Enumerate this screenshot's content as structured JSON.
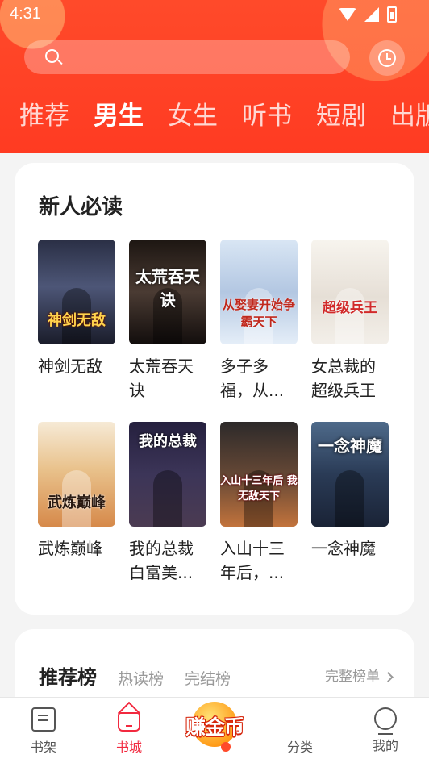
{
  "status_bar": {
    "time": "4:31"
  },
  "search": {
    "placeholder": ""
  },
  "tabs": [
    {
      "label": "推荐",
      "active": false
    },
    {
      "label": "男生",
      "active": true
    },
    {
      "label": "女生",
      "active": false
    },
    {
      "label": "听书",
      "active": false
    },
    {
      "label": "短剧",
      "active": false
    },
    {
      "label": "出版",
      "active": false
    }
  ],
  "section1": {
    "title": "新人必读",
    "books": [
      {
        "title": "神剑无敌",
        "cover_text": "神剑无敌"
      },
      {
        "title": "太荒吞天诀",
        "cover_text": "太荒吞天诀"
      },
      {
        "title": "多子多福，从...",
        "cover_text": "从娶妻开始争霸天下"
      },
      {
        "title": "女总裁的超级兵王",
        "cover_text": "超级兵王"
      },
      {
        "title": "武炼巅峰",
        "cover_text": "武炼巅峰"
      },
      {
        "title": "我的总裁白富美...",
        "cover_text": "我的总裁"
      },
      {
        "title": "入山十三年后，...",
        "cover_text": "入山十三年后 我无敌天下"
      },
      {
        "title": "一念神魔",
        "cover_text": "一念神魔"
      }
    ]
  },
  "section2": {
    "title": "推荐榜",
    "tabs": [
      "热读榜",
      "完结榜"
    ],
    "more": "完整榜单"
  },
  "bottom_nav": {
    "shelf": "书架",
    "store": "书城",
    "coin": "赚金币",
    "category": "分类",
    "me": "我的"
  },
  "colors": {
    "accent": "#ff3b22",
    "nav_active": "#f2293f"
  }
}
